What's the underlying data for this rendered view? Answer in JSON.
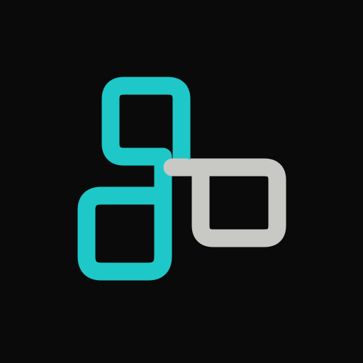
{
  "logo": {
    "icon": "app-logo-icon",
    "colors": {
      "background": "#0a0a0a",
      "primary": "#1ec8c8",
      "secondary": "#c8c8c5"
    }
  }
}
